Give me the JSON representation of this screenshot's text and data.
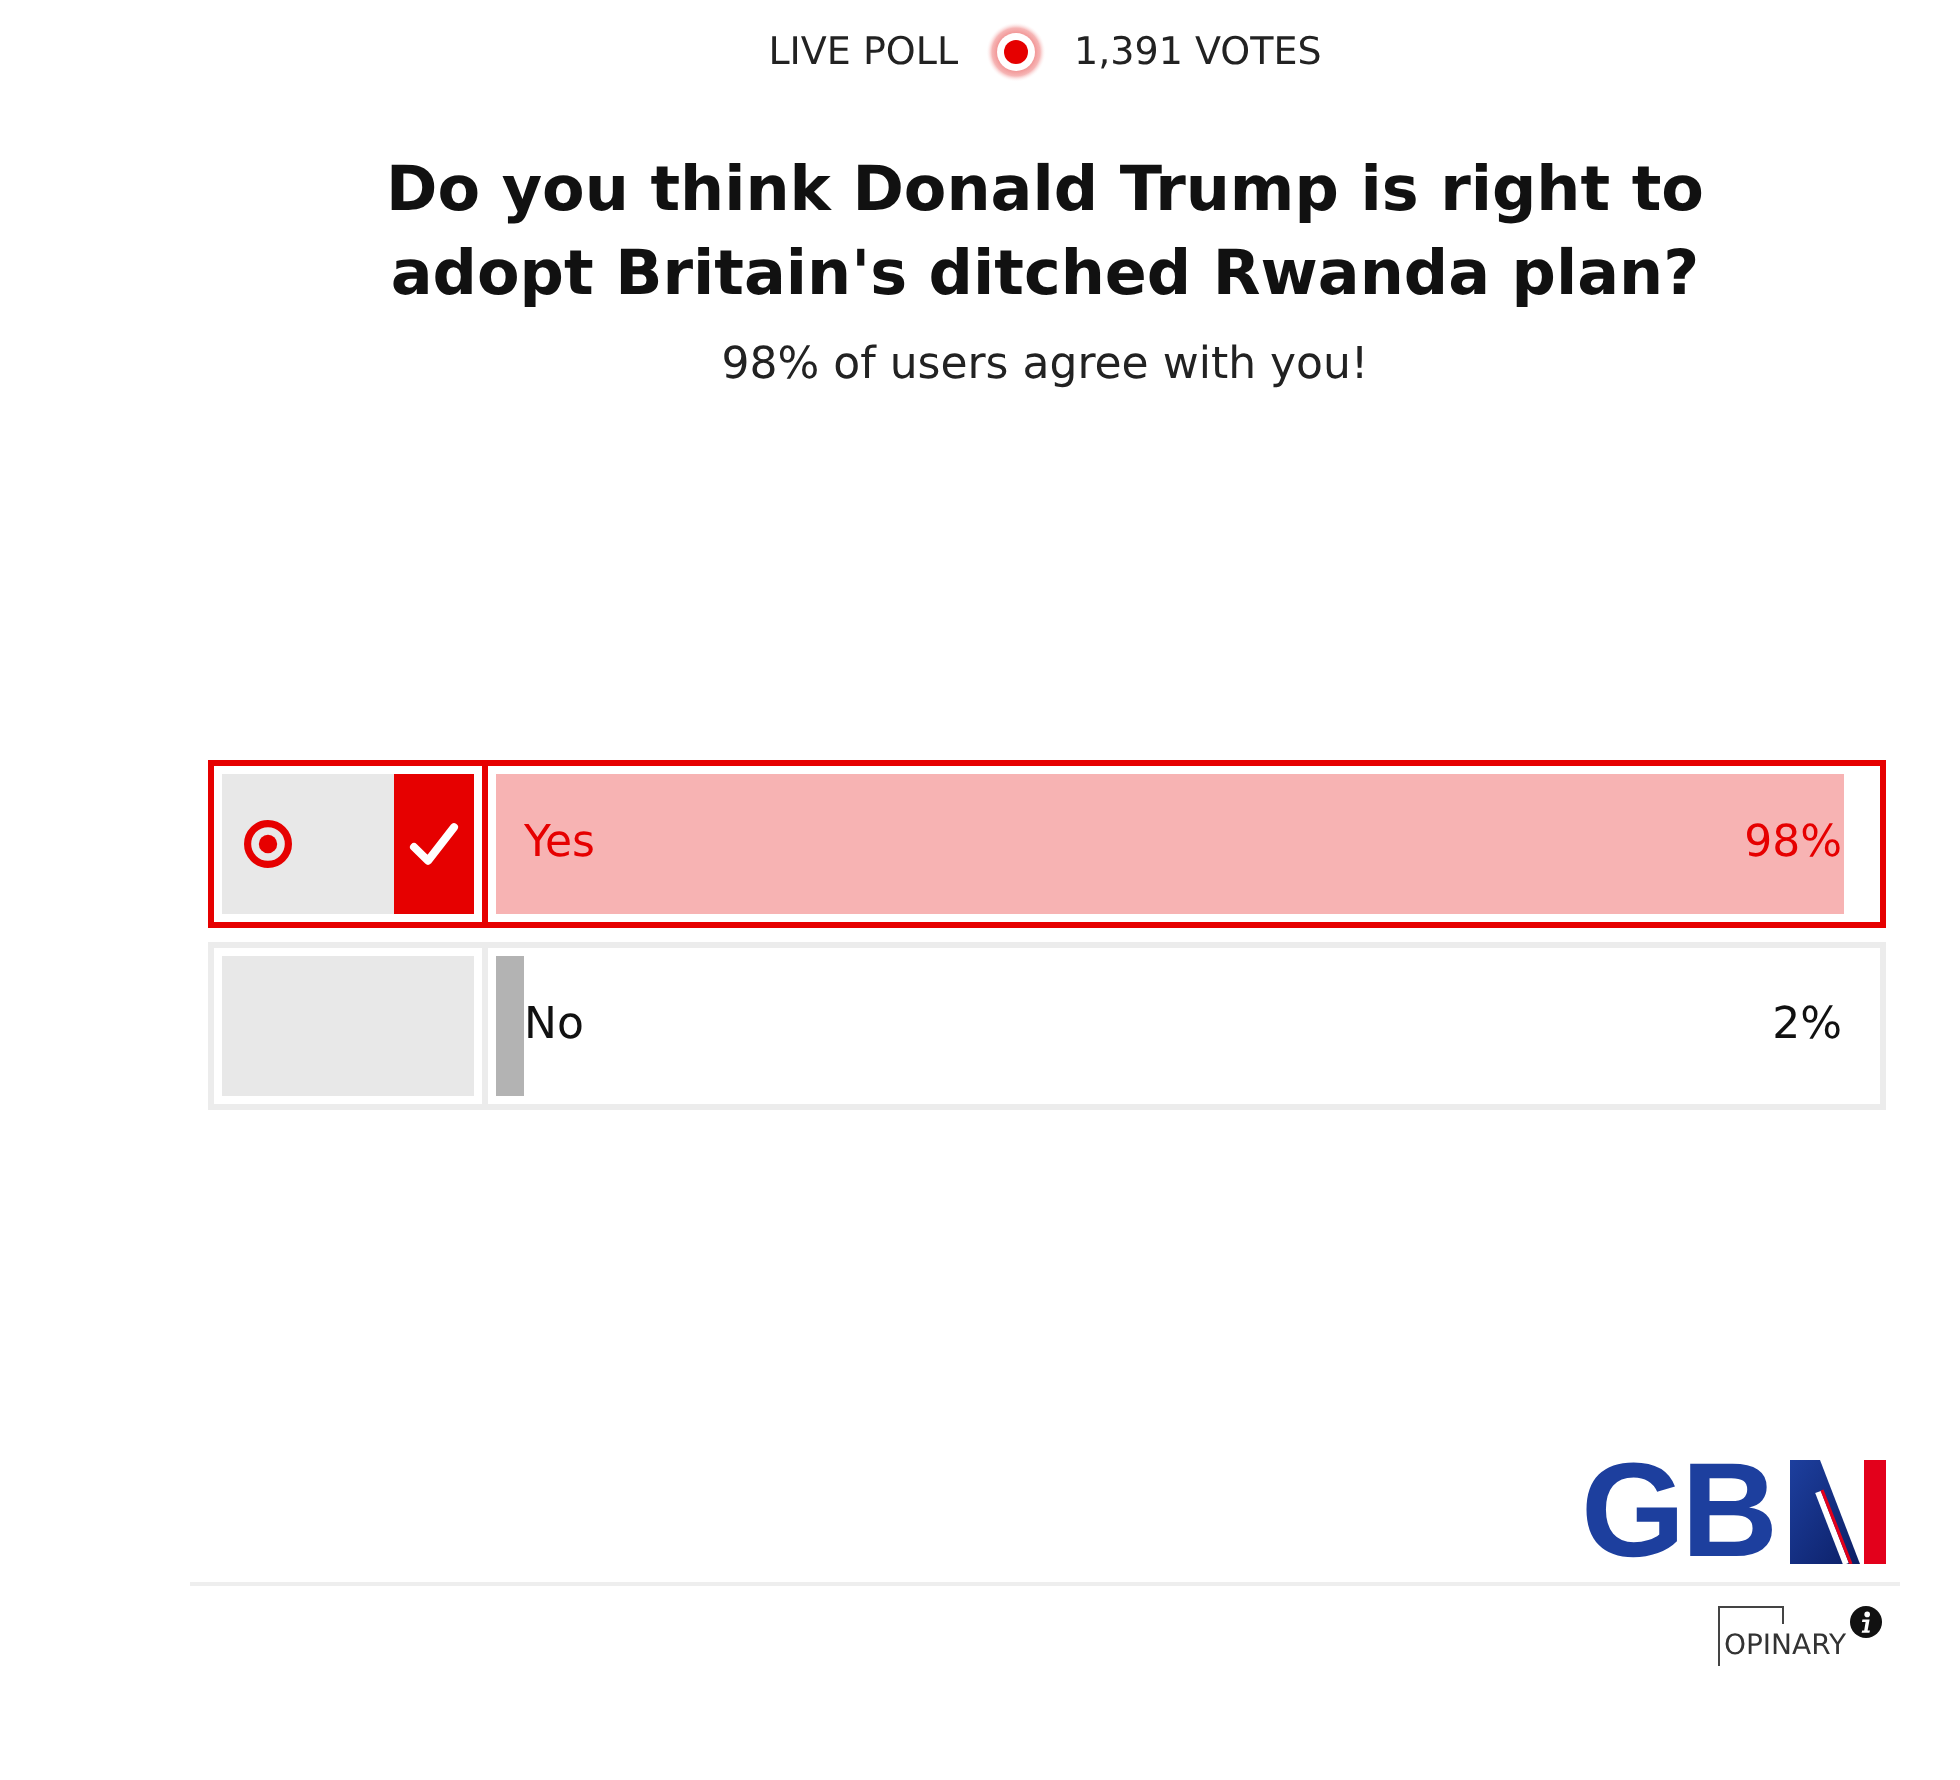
{
  "header": {
    "label": "LIVE POLL",
    "votes": "1,391 VOTES"
  },
  "question": "Do you think Donald Trump is right to adopt Britain's ditched Rwanda plan?",
  "result_message": "98% of users agree with you!",
  "options": [
    {
      "label": "Yes",
      "percent": "98%",
      "level": 0.98,
      "selected": true
    },
    {
      "label": "No",
      "percent": "2%",
      "level": 0.02,
      "selected": false
    }
  ],
  "logo": {
    "text": "GB"
  },
  "credit": {
    "text": "OPINARY"
  }
}
